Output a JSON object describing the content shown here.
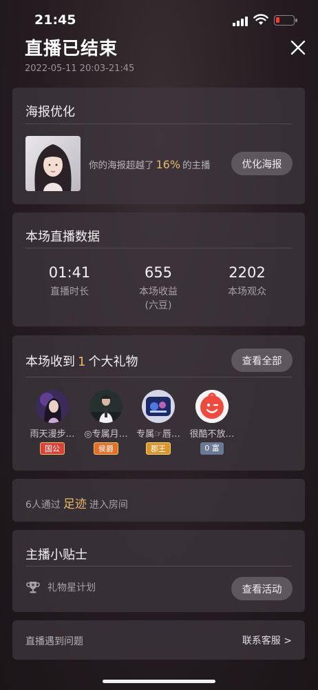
{
  "status_bar": {
    "time": "21:45"
  },
  "header": {
    "title": "直播已结束",
    "time_range": "2022-05-11 20:03-21:45"
  },
  "poster": {
    "title": "海报优化",
    "text_before": "你的海报超越了",
    "percent": "16%",
    "text_after": "的主播",
    "button": "优化海报"
  },
  "stats": {
    "title": "本场直播数据",
    "items": [
      {
        "value": "01:41",
        "label": "直播时长",
        "sub": ""
      },
      {
        "value": "655",
        "label": "本场收益",
        "sub": "(六豆)"
      },
      {
        "value": "2202",
        "label": "本场观众",
        "sub": ""
      }
    ]
  },
  "gifts": {
    "title_before": "本场收到",
    "count": "1",
    "title_after": "个大礼物",
    "view_all": "查看全部",
    "gifters": [
      {
        "name": "雨天漫步…",
        "badge": "国公",
        "badge_color": "#d9423a"
      },
      {
        "name": "◎专属月…",
        "badge": "侯爵",
        "badge_color": "#e0702c"
      },
      {
        "name": "专属☞唇…",
        "badge": "郡王",
        "badge_color": "#d9962c"
      },
      {
        "name": "很酷不放…",
        "badge": "0 富",
        "badge_color": "#6a7a94"
      }
    ]
  },
  "footprint": {
    "text_before": "6人通过",
    "highlight": "足迹",
    "text_after": "进入房间"
  },
  "tips": {
    "title": "主播小贴士",
    "item": "礼物星计划",
    "button": "查看活动"
  },
  "issue": {
    "label": "直播遇到问题",
    "link": "联系客服 >"
  }
}
